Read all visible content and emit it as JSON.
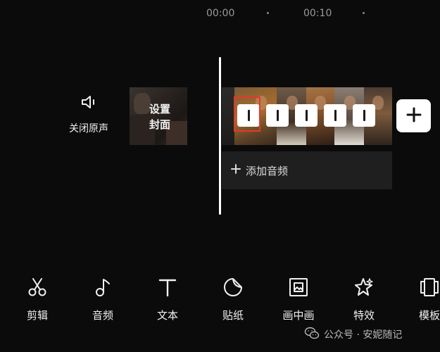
{
  "timeline": {
    "time_marks": [
      "00:00",
      "00:10"
    ]
  },
  "track_controls": {
    "mute_label": "关闭原声",
    "mute_icon": "speaker-icon",
    "cover_label_line1": "设置",
    "cover_label_line2": "封面"
  },
  "clip": {
    "frame_count": 6,
    "add_clip_icon": "plus-icon"
  },
  "audio": {
    "add_audio_label": "添加音频",
    "add_audio_icon": "plus-icon"
  },
  "toolbar": {
    "items": [
      {
        "label": "剪辑",
        "icon": "scissors-icon"
      },
      {
        "label": "音频",
        "icon": "music-note-icon"
      },
      {
        "label": "文本",
        "icon": "text-icon"
      },
      {
        "label": "贴纸",
        "icon": "sticker-icon"
      },
      {
        "label": "画中画",
        "icon": "picture-in-picture-icon"
      },
      {
        "label": "特效",
        "icon": "effects-star-icon"
      },
      {
        "label": "模板",
        "icon": "template-icon"
      }
    ]
  },
  "watermark": {
    "text": "公众号 · 安妮随记",
    "icon": "wechat-icon"
  },
  "colors": {
    "background": "#0b0b0b",
    "highlight_box": "#e5382b",
    "playhead": "#ffffff"
  }
}
